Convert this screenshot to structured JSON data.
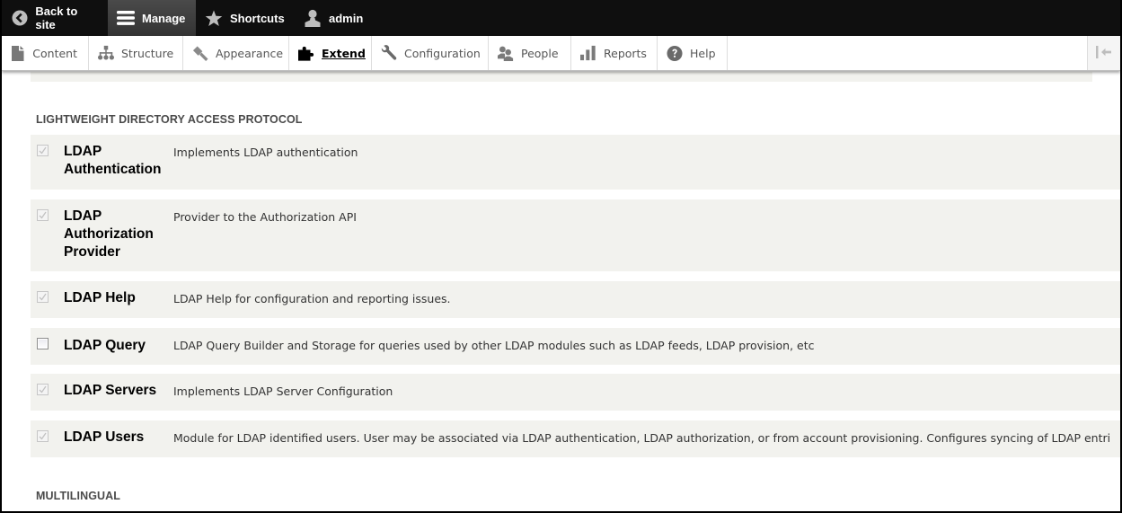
{
  "toolbar": {
    "back_to_site": "Back to site",
    "manage": "Manage",
    "shortcuts": "Shortcuts",
    "user": "admin"
  },
  "tray": {
    "items": [
      {
        "label": "Content",
        "icon": "file-icon"
      },
      {
        "label": "Structure",
        "icon": "sitemap-icon"
      },
      {
        "label": "Appearance",
        "icon": "paintbrush-icon"
      },
      {
        "label": "Extend",
        "icon": "puzzle-icon",
        "active": true
      },
      {
        "label": "Configuration",
        "icon": "wrench-icon"
      },
      {
        "label": "People",
        "icon": "people-icon"
      },
      {
        "label": "Reports",
        "icon": "bar-chart-icon"
      },
      {
        "label": "Help",
        "icon": "help-icon"
      }
    ],
    "collapse_icon": "collapse-tray-icon"
  },
  "sections": [
    {
      "title": "LIGHTWEIGHT DIRECTORY ACCESS PROTOCOL",
      "modules": [
        {
          "name": "LDAP Authentication",
          "description": "Implements LDAP authentication",
          "checked": true,
          "disabled": true
        },
        {
          "name": "LDAP Authorization Provider",
          "description": "Provider to the Authorization API",
          "checked": true,
          "disabled": true
        },
        {
          "name": "LDAP Help",
          "description": "LDAP Help for configuration and reporting issues.",
          "checked": true,
          "disabled": true
        },
        {
          "name": "LDAP Query",
          "description": "LDAP Query Builder and Storage for queries used by other LDAP modules such as LDAP feeds, LDAP provision, etc",
          "checked": false,
          "disabled": false
        },
        {
          "name": "LDAP Servers",
          "description": "Implements LDAP Server Configuration",
          "checked": true,
          "disabled": true
        },
        {
          "name": "LDAP Users",
          "description": "Module for LDAP identified users. User may be associated via LDAP authentication, LDAP authorization, or from account provisioning. Configures syncing of LDAP entri",
          "checked": true,
          "disabled": true
        }
      ]
    },
    {
      "title": "MULTILINGUAL",
      "modules": []
    }
  ]
}
